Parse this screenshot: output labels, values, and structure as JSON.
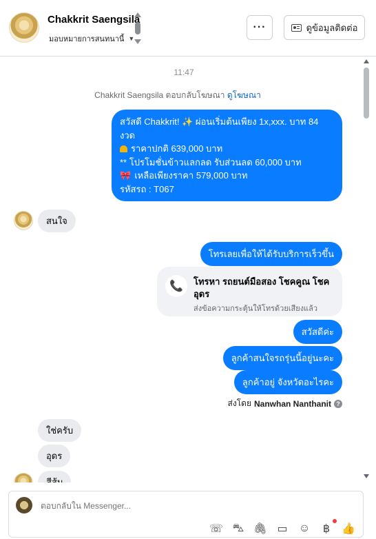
{
  "header": {
    "contact_name": "Chakkrit Saengsila",
    "assign_label": "มอบหมายการสนทนานี้",
    "more_label": "···",
    "contact_info_label": "ดูข้อมูลติดต่อ"
  },
  "chat": {
    "time": "11:47",
    "ad_reply_text": "Chakkrit Saengsila ตอบกลับโฆษณา",
    "ad_reply_link": "ดูโฆษณา",
    "ad_message": {
      "line1": "สวัสดี Chakkrit! ✨  ผ่อนเริ่มต้นเพียง 1x,xxx. บาท 84 งวด",
      "line2": "ราคาปกติ 639,000 บาท",
      "line3": "** โปรโมชั่นข้าวแลกลด รับส่วนลด 60,000 บาท",
      "line4": "เหลือเพียงราคา 579,000 บาท",
      "line5": " รหัสรถ : T067"
    },
    "msg_interested": "สนใจ",
    "msg_call_prompt": "โทรเลยเพื่อให้ได้รับบริการเร็วขึ้น",
    "call_card": {
      "title": "โทรหา รถยนต์มือสอง โชคคูณ โชค อุดร",
      "subtitle": "ส่งข้อความกระตุ้นให้โทรด้วยเสียงแล้ว"
    },
    "msg_hello": "สวัสดีค่ะ",
    "msg_interest_model": "ลูกค้าสนใจรถรุ่นนี้อยู่นะคะ",
    "msg_province": "ลูกค้าอยู่ จังหวัดอะไรคะ",
    "sent_by_label": "ส่งโดย",
    "sent_by_name": "Nanwhan Nanthanit",
    "reply_yes": "ใช่ครับ",
    "reply_udon": "อุดร",
    "reply_partial": "สีส้ม"
  },
  "composer": {
    "placeholder": "ตอบกลับใน Messenger..."
  },
  "icons": [
    "more-icon",
    "contact-card-icon",
    "phone-icon",
    "call-add-icon",
    "shopping-bag-icon",
    "attachment-icon",
    "saved-reply-icon",
    "emoji-icon",
    "baht-icon",
    "thumbs-up-icon",
    "info-icon"
  ],
  "colors": {
    "outgoing_bubble": "#0a7cff",
    "incoming_bubble": "#e9ebee",
    "link": "#0a66c2"
  }
}
